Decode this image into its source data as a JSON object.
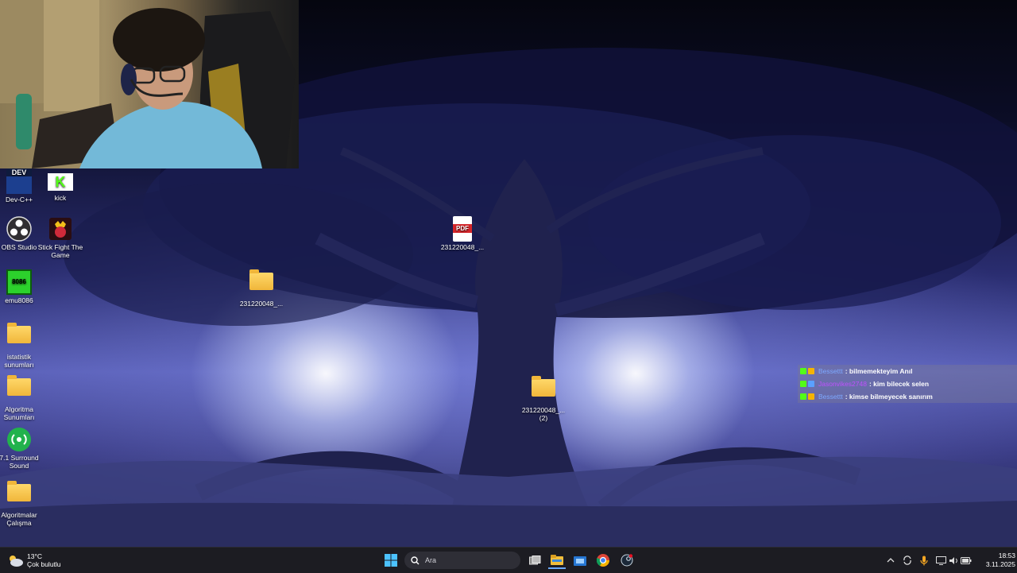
{
  "desktop": {
    "icons": [
      {
        "label": "Dev-C++",
        "icon": "devcpp-icon"
      },
      {
        "label": "kick",
        "icon": "kick-icon"
      },
      {
        "label": "OBS Studio",
        "icon": "obs-icon"
      },
      {
        "label": "Stick Fight The Game",
        "icon": "stickfight-icon"
      },
      {
        "label": "emu8086",
        "icon": "emu8086-icon"
      },
      {
        "label": "istatistik sunumları",
        "icon": "folder-icon"
      },
      {
        "label": "Algoritma Sunumları",
        "icon": "folder-icon"
      },
      {
        "label": "7.1 Surround Sound",
        "icon": "surround-icon"
      },
      {
        "label": "Algoritmalar Çalışma",
        "icon": "folder-icon"
      },
      {
        "label": "231220048_...",
        "icon": "pdf-icon"
      },
      {
        "label": "231220048_...",
        "icon": "folder-icon"
      },
      {
        "label": "231220048_... (2)",
        "icon": "folder-icon"
      }
    ],
    "icon_text": {
      "dev": "DEV",
      "kick": "K",
      "emu": "8086",
      "pdf": "PDF"
    }
  },
  "chat": {
    "messages": [
      {
        "user": "Bessettt",
        "user_color": "#7da8ff",
        "text": ": bilmemekteyim Anıl"
      },
      {
        "user": "Jasonvikes2748",
        "user_color": "#c050ff",
        "text": ": kim bilecek selen"
      },
      {
        "user": "Bessettt",
        "user_color": "#7da8ff",
        "text": ": kimse bilmeyecek sanırım"
      }
    ],
    "badge_colors": [
      "#53fc18",
      "#f5b400"
    ]
  },
  "taskbar": {
    "weather": {
      "temp": "13°C",
      "desc": "Çok bulutlu",
      "icon": "cloud-sun-icon"
    },
    "search_placeholder": "Ara",
    "apps": [
      "start-icon",
      "search-icon",
      "task-view-icon",
      "file-explorer-icon",
      "store-icon",
      "chrome-icon",
      "steam-icon"
    ],
    "tray": [
      "chevron-up-icon",
      "sync-icon",
      "microphone-icon",
      "display-icon",
      "volume-icon",
      "battery-icon"
    ],
    "time": "18:53",
    "date": "3.11.2025"
  }
}
